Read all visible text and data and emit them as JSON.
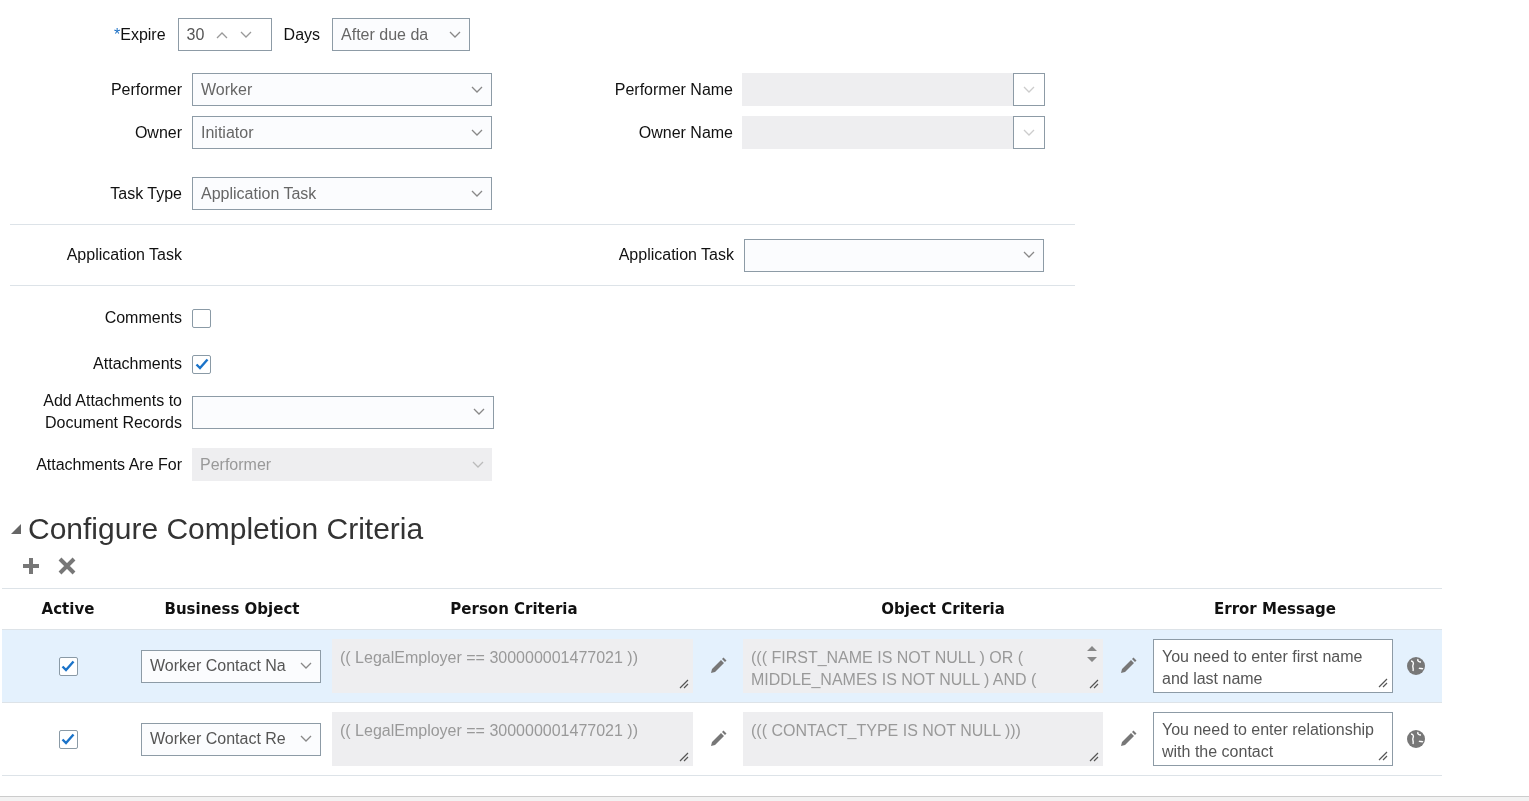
{
  "expire": {
    "label": "Expire",
    "required_mark": "*",
    "value": "30",
    "unit": "Days",
    "relative": "After due da"
  },
  "people": [
    {
      "label": "Performer",
      "value": "Worker",
      "name_label": "Performer Name"
    },
    {
      "label": "Owner",
      "value": "Initiator",
      "name_label": "Owner Name"
    }
  ],
  "task_type": {
    "label": "Task Type",
    "value": "Application Task"
  },
  "application_task": {
    "label": "Application Task",
    "field_label": "Application Task"
  },
  "options": [
    {
      "label": "Comments",
      "checked": false
    },
    {
      "label": "Attachments",
      "checked": true
    }
  ],
  "add_attachments": {
    "label": "Add Attachments to Document Records"
  },
  "attachments_for": {
    "label": "Attachments Are For",
    "value": "Performer",
    "disabled": true
  },
  "section": {
    "title": "Configure Completion Criteria",
    "expanded": true
  },
  "table": {
    "columns": [
      "Active",
      "Business Object",
      "Person Criteria",
      "Object Criteria",
      "Error Message"
    ],
    "rows": [
      {
        "active": true,
        "selected": true,
        "business_object": "Worker Contact Na",
        "person_criteria": "(( LegalEmployer == 300000001477021 ))",
        "object_criteria": "((( FIRST_NAME IS NOT NULL ) OR ( MIDDLE_NAMES IS NOT NULL ) AND (",
        "error_message": "You need to enter first name and last name"
      },
      {
        "active": true,
        "selected": false,
        "business_object": "Worker Contact Re",
        "person_criteria": "(( LegalEmployer == 300000001477021 ))",
        "object_criteria": "((( CONTACT_TYPE IS NOT NULL )))",
        "error_message": "You need to enter relationship with the contact"
      }
    ]
  }
}
